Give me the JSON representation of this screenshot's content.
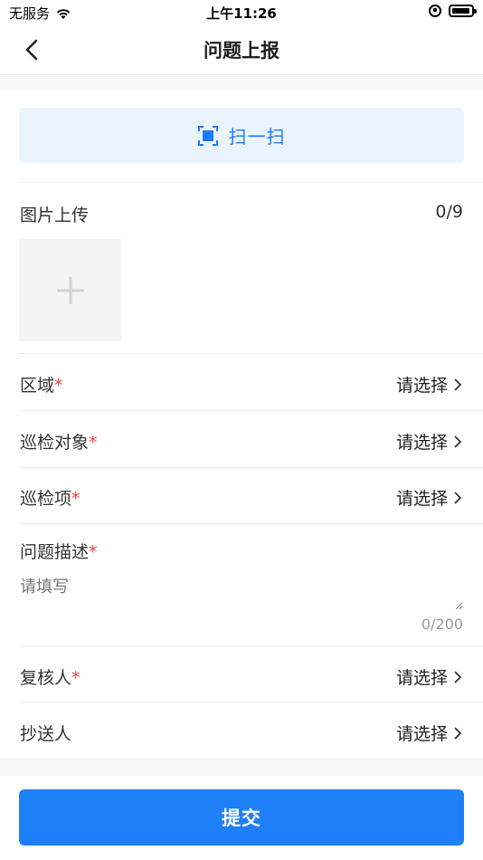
{
  "status_bar": {
    "carrier": "无服务",
    "time": "上午11:26"
  },
  "nav": {
    "title": "问题上报"
  },
  "scan": {
    "label": "扫一扫"
  },
  "upload": {
    "label": "图片上传",
    "count": "0/9"
  },
  "fields": {
    "area": {
      "label": "区域",
      "value": "请选择"
    },
    "inspect_object": {
      "label": "巡检对象",
      "value": "请选择"
    },
    "inspect_item": {
      "label": "巡检项",
      "value": "请选择"
    },
    "description": {
      "label": "问题描述",
      "placeholder": "请填写",
      "counter": "0/200"
    },
    "reviewer": {
      "label": "复核人",
      "value": "请选择"
    },
    "cc": {
      "label": "抄送人",
      "value": "请选择"
    }
  },
  "required_mark": "*",
  "submit": {
    "label": "提交"
  },
  "colors": {
    "accent": "#1f7ff6",
    "scan_bg": "#eaf4fe",
    "required": "#f03c3c"
  }
}
